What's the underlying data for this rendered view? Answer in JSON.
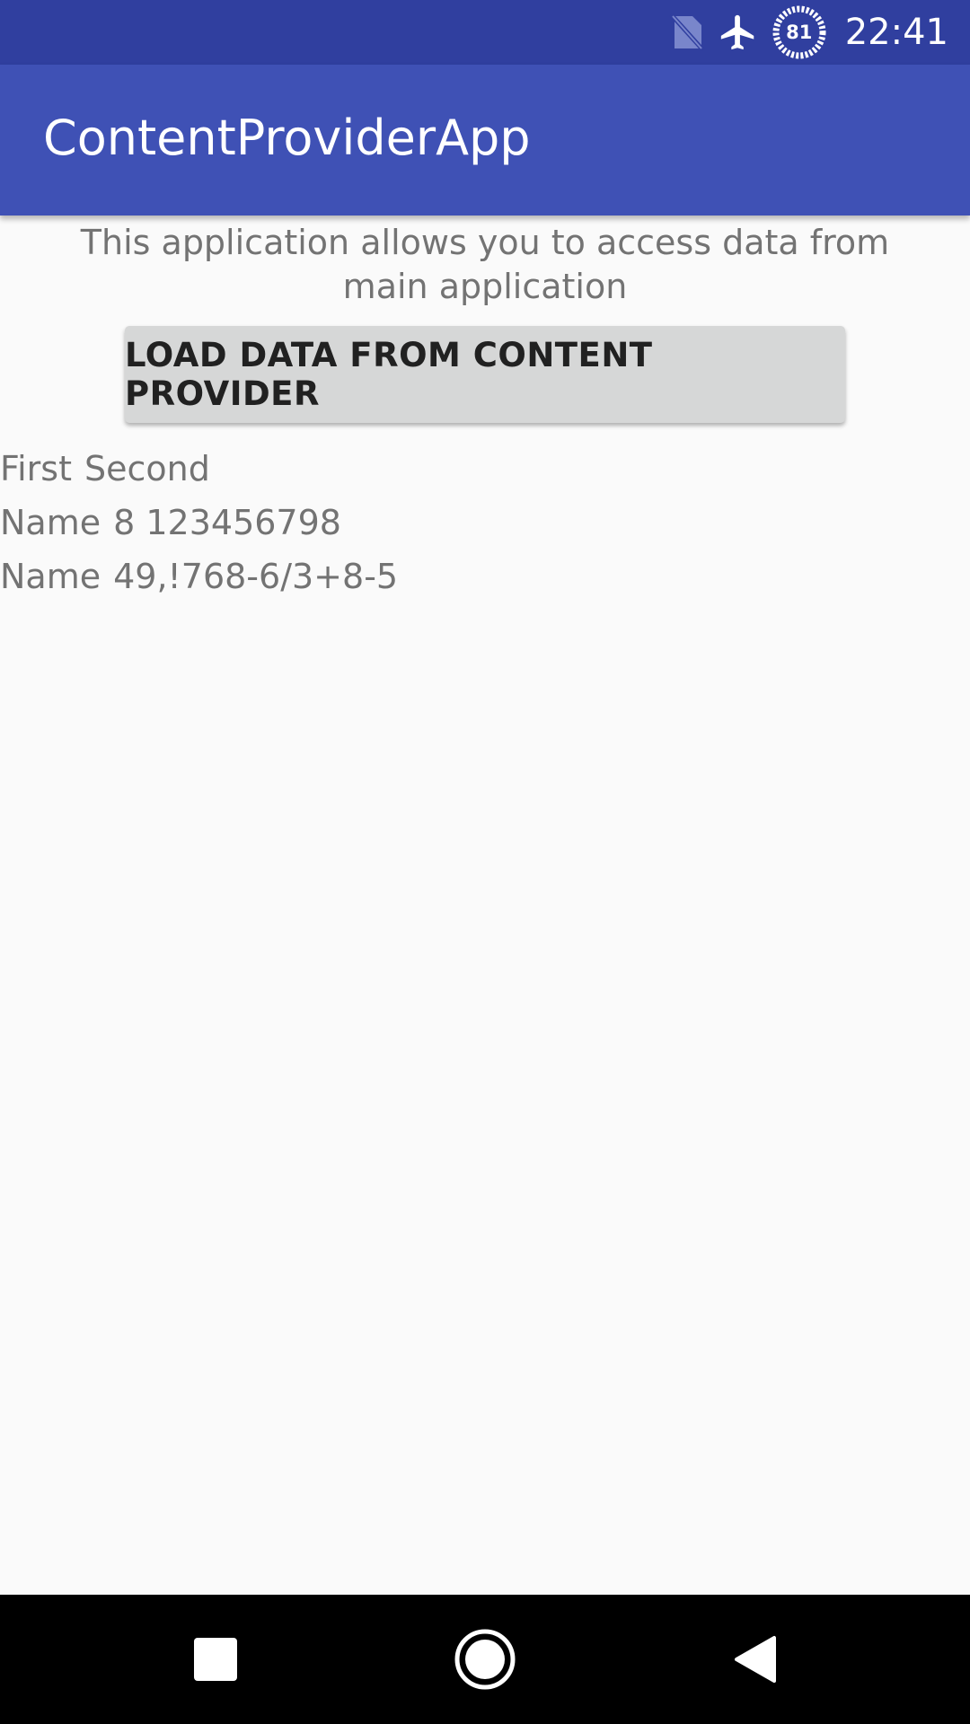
{
  "status_bar": {
    "time": "22:41",
    "battery_level": "81",
    "icons": [
      "no-sim-icon",
      "airplane-mode-icon",
      "battery-saver-icon"
    ]
  },
  "app_bar": {
    "title": "ContentProviderApp",
    "color": "#3f51b5",
    "status_color": "#303f9f"
  },
  "main": {
    "description": "This application allows you to access data from main application",
    "load_button_label": "LOAD DATA FROM CONTENT PROVIDER",
    "rows": [
      {
        "first": "First",
        "second": "Second"
      },
      {
        "first": "Name",
        "second": "8 123456798"
      },
      {
        "first": "Name",
        "second": "49,!768-6/3+8-5"
      }
    ]
  },
  "nav_bar": {
    "icons": [
      "recents-square-icon",
      "home-circle-icon",
      "back-triangle-icon"
    ]
  }
}
